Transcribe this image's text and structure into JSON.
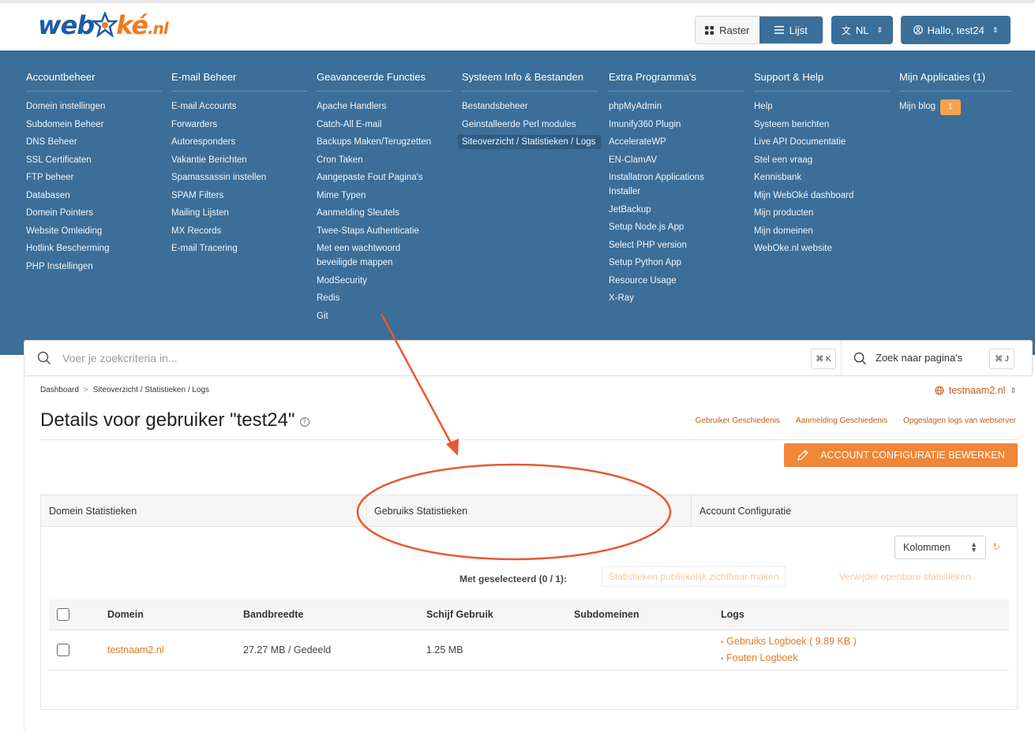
{
  "header": {
    "logo_text": "webOké.nl",
    "view_raster": "Raster",
    "view_lijst": "Lijst",
    "language": "NL",
    "user": "Hallo, test24"
  },
  "menu": {
    "columns": [
      {
        "title": "Accountbeheer",
        "items": [
          "Domein instellingen",
          "Subdomein Beheer",
          "DNS Beheer",
          "SSL Certificaten",
          "FTP beheer",
          "Databasen",
          "Domein Pointers",
          "Website Omleiding",
          "Hotlink Bescherming",
          "PHP Instellingen"
        ]
      },
      {
        "title": "E-mail Beheer",
        "items": [
          "E-mail Accounts",
          "Forwarders",
          "Autoresponders",
          "Vakantie Berichten",
          "Spamassassin instellen",
          "SPAM Filters",
          "Mailing Lijsten",
          "MX Records",
          "E-mail Tracering"
        ]
      },
      {
        "title": "Geavanceerde Functies",
        "items": [
          "Apache Handlers",
          "Catch-All E-mail",
          "Backups Maken/Terugzetten",
          "Cron Taken",
          "Aangepaste Fout Pagina's",
          "Mime Typen",
          "Aanmelding Sleutels",
          "Twee-Staps Authenticatie",
          "Met een wachtwoord beveiligde mappen",
          "ModSecurity",
          "Redis",
          "Git"
        ]
      },
      {
        "title": "Systeem Info & Bestanden",
        "items": [
          "Bestandsbeheer",
          "Geinstalleerde Perl modules",
          "Siteoverzicht / Statistieken / Logs"
        ]
      },
      {
        "title": "Extra Programma's",
        "items": [
          "phpMyAdmin",
          "Imunify360 Plugin",
          "AccelerateWP",
          "EN-ClamAV",
          "Installatron Applications Installer",
          "JetBackup",
          "Setup Node.js App",
          "Select PHP version",
          "Setup Python App",
          "Resource Usage",
          "X-Ray"
        ]
      },
      {
        "title": "Support & Help",
        "items": [
          "Help",
          "Systeem berichten",
          "Live API Documentatie",
          "Stel een vraag",
          "Kennisbank",
          "Mijn WebOké dashboard",
          "Mijn producten",
          "Mijn domeinen",
          "WebOke.nl website"
        ]
      },
      {
        "title": "Mijn Applicaties (1)",
        "items": [
          "Mijn blog"
        ],
        "badge": "1"
      }
    ]
  },
  "search": {
    "placeholder": "Voer je zoekcriteria in...",
    "shortcut": "⌘ K",
    "pages_label": "Zoek naar pagina's",
    "pages_shortcut": "⌘ J"
  },
  "breadcrumb": {
    "home": "Dashboard",
    "sep": ">",
    "current": "Siteoverzicht / Statistieken / Logs"
  },
  "domain_selector": "testnaam2.nl",
  "page": {
    "title": "Details voor gebruiker \"test24\"",
    "help": "?",
    "links": [
      "Gebruiker Geschiedenis",
      "Aanmelding Geschiedenis",
      "Opgeslagen logs van webserver"
    ],
    "edit_button": "ACCOUNT CONFIGURATIE BEWERKEN"
  },
  "tabs": [
    "Domein Statistieken",
    "Gebruiks Statistieken",
    "Account Configuratie"
  ],
  "toolbar": {
    "columns_label": "Kolommen",
    "selected_label": "Met geselecteerd (0 / 1):",
    "action1": "Statistieken publiekelijk zichtbaar maken",
    "action2": "Verwijder openbare statistieken"
  },
  "table": {
    "headers": [
      "Domein",
      "Bandbreedte",
      "Schijf Gebruik",
      "Subdomeinen",
      "Logs"
    ],
    "rows": [
      {
        "domain": "testnaam2.nl",
        "bandwidth": "27.27 MB / Gedeeld",
        "disk": "1.25 MB",
        "subdomains": "",
        "logs": [
          "Gebruiks Logboek ( 9.89 KB )",
          "Fouten Logboek"
        ]
      }
    ]
  },
  "colors": {
    "menu_bg": "#3b6e98",
    "accent": "#ef8638",
    "annotation": "#e65a2e"
  }
}
